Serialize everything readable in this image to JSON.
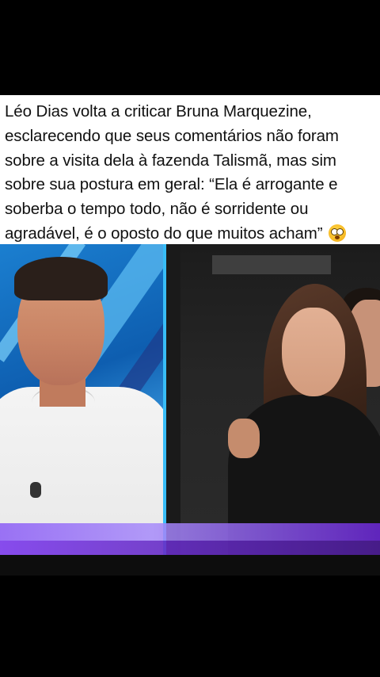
{
  "post": {
    "caption": "Léo Dias volta a criticar Bruna Marquezine, esclarecendo que seus comentários não foram sobre a visita dela à fazenda Talismã, mas sim sobre sua postura em geral: “Ela é arrogante e soberba o tempo todo, não é sorridente ou agradável, é o oposto do que muitos acham”",
    "emoji": "flushed-face-icon"
  },
  "colors": {
    "background": "#000000",
    "caption_bg": "#ffffff",
    "studio_blue": "#1b7fd0",
    "overlay_purple": "#8b5cf6"
  }
}
